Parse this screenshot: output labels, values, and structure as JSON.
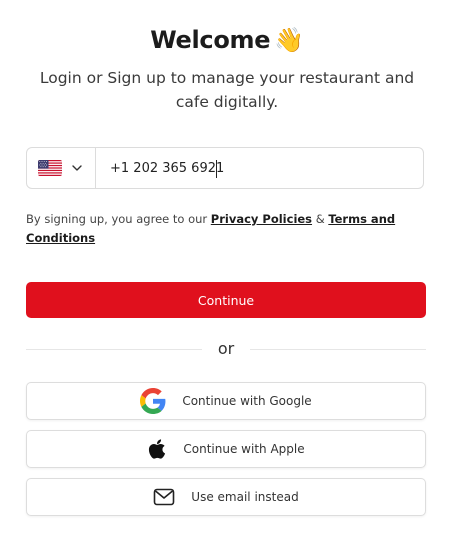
{
  "header": {
    "title": "Welcome",
    "title_emoji": "👋",
    "subtitle": "Login or Sign up to manage your restaurant and cafe digitally."
  },
  "phone": {
    "country_flag": "us-flag-icon",
    "value": "+1 202 365 6921"
  },
  "terms": {
    "prefix": "By signing up, you agree to our",
    "privacy_link": "Privacy Policies",
    "joiner": "&",
    "terms_link": "Terms and Conditions"
  },
  "actions": {
    "continue_label": "Continue",
    "continue_color": "#e0101d",
    "divider_label": "or",
    "google_label": "Continue with Google",
    "apple_label": "Continue with Apple",
    "email_label": "Use email instead"
  }
}
